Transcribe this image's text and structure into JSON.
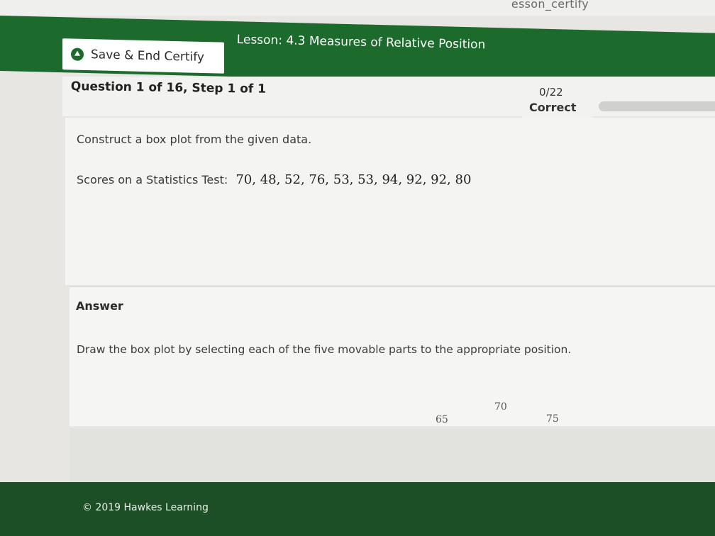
{
  "browser": {
    "url_fragment": "esson_certify"
  },
  "header": {
    "save_button_label": "Save & End Certify",
    "lesson_title": "Lesson: 4.3 Measures of Relative Position"
  },
  "question": {
    "title": "Question 1 of 16, Step 1 of 1",
    "score": "0/22",
    "status": "Correct",
    "prompt": "Construct a box plot from the given data.",
    "data_label": "Scores on a Statistics Test:",
    "data_values": "70, 48, 52, 76, 53, 53, 94, 92, 92, 80"
  },
  "answer": {
    "title": "Answer",
    "instructions": "Draw the box plot by selecting each of the five movable parts to the appropriate position.",
    "axis_ticks": [
      "65",
      "70",
      "75"
    ]
  },
  "footer": {
    "copyright": "© 2019 Hawkes Learning"
  },
  "colors": {
    "brand_green": "#1c6a2c",
    "footer_green": "#1d4f26"
  }
}
